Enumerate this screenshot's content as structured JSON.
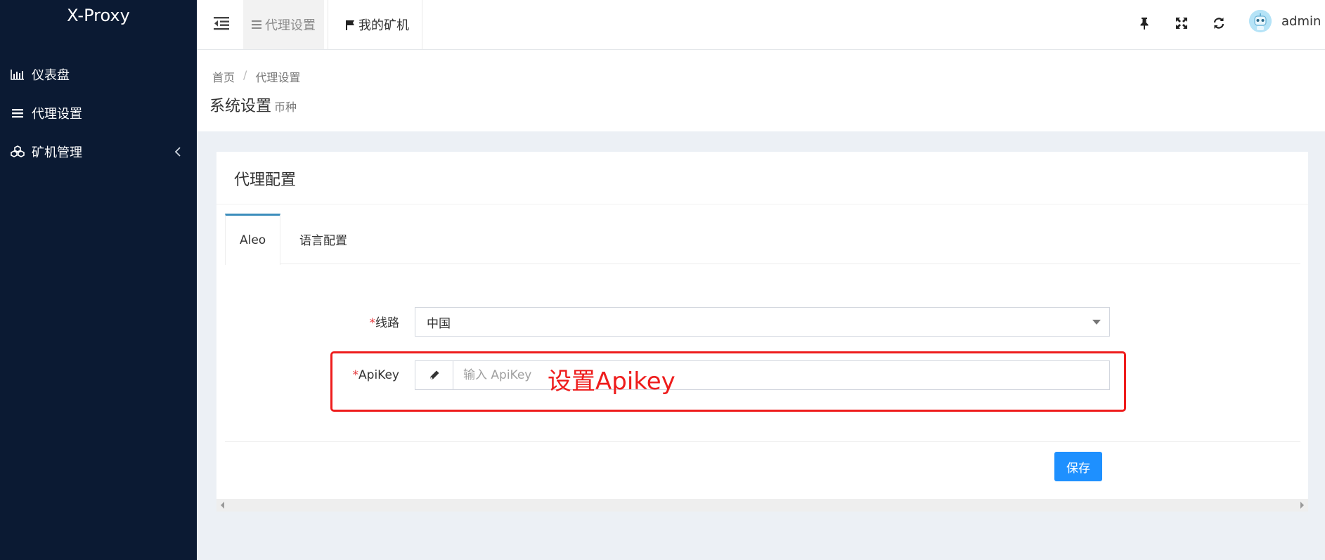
{
  "app": {
    "brand": "X-Proxy"
  },
  "sidebar": {
    "items": [
      {
        "label": "仪表盘",
        "icon": "bar-chart-icon"
      },
      {
        "label": "代理设置",
        "icon": "list-icon"
      },
      {
        "label": "矿机管理",
        "icon": "cubes-icon",
        "has_submenu": true
      }
    ]
  },
  "topbar": {
    "tabs": [
      {
        "label": "代理设置",
        "icon": "list-icon",
        "active": true
      },
      {
        "label": "我的矿机",
        "icon": "flag-icon",
        "active": false
      }
    ],
    "tools": [
      "pin-icon",
      "fullscreen-icon",
      "refresh-icon"
    ],
    "user": "admin"
  },
  "breadcrumb": {
    "home": "首页",
    "sep": "/",
    "current": "代理设置"
  },
  "page": {
    "title": "系统设置",
    "subtitle": "币种"
  },
  "card": {
    "title": "代理配置",
    "tabs": [
      {
        "label": "Aleo",
        "active": true
      },
      {
        "label": "语言配置",
        "active": false
      }
    ],
    "form": {
      "route": {
        "required": "*",
        "label": "线路",
        "value": "中国"
      },
      "apikey": {
        "required": "*",
        "label": "ApiKey",
        "placeholder": "输入 ApiKey",
        "value": ""
      }
    },
    "annotation": "设置Apikey",
    "save_label": "保存"
  },
  "colors": {
    "sidebar_bg": "#0b1a33",
    "primary": "#1e90ff",
    "annotation": "#ee1c1c"
  }
}
